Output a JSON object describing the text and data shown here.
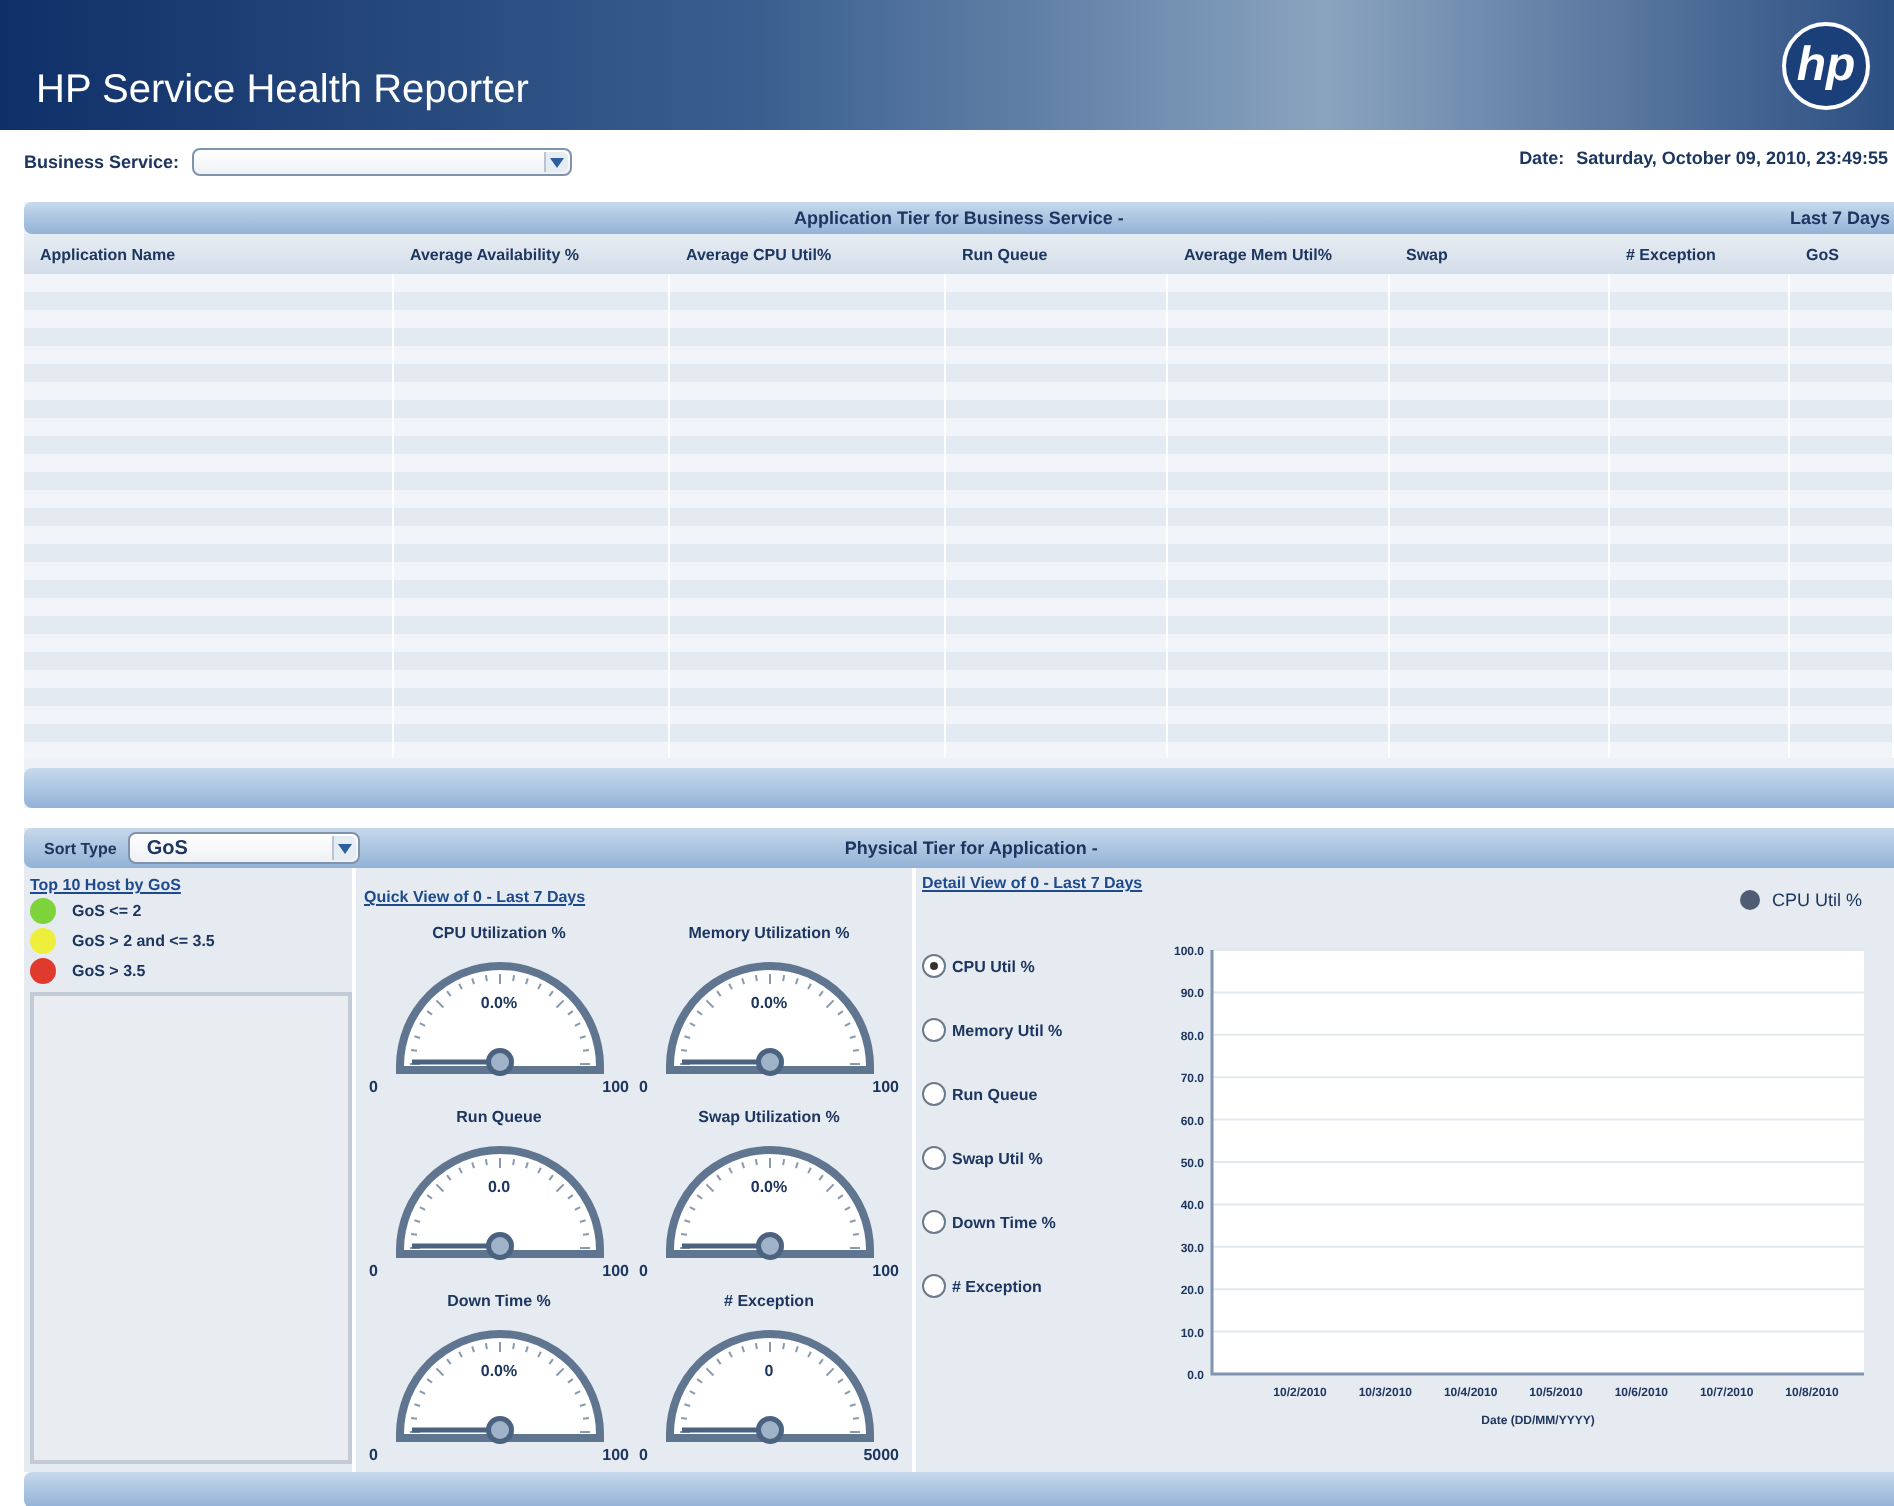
{
  "header": {
    "title": "HP Service Health Reporter",
    "logo": "hp"
  },
  "business_service": {
    "label": "Business Service:"
  },
  "date": {
    "label": "Date:",
    "value": "Saturday, October 09, 2010, 23:49:55"
  },
  "application_tier": {
    "title": "Application Tier for Business Service -",
    "range": "Last 7 Days",
    "columns": [
      "Application Name",
      "Average Availability %",
      "Average CPU Util%",
      "Run Queue",
      "Average Mem Util%",
      "Swap",
      "# Exception",
      "GoS"
    ]
  },
  "physical_tier": {
    "sort_label": "Sort Type",
    "sort_value": "GoS",
    "title": "Physical Tier for Application -",
    "hosts": {
      "title": "Top 10 Host by GoS",
      "legend": [
        {
          "label": "GoS <= 2",
          "color": "#7ed23a"
        },
        {
          "label": "GoS > 2 and <= 3.5",
          "color": "#eeee3c"
        },
        {
          "label": "GoS > 3.5",
          "color": "#e03a2e"
        }
      ]
    },
    "quick_view": {
      "title": "Quick View of 0 - Last 7 Days",
      "gauges": [
        {
          "title": "CPU Utilization %",
          "reading": "0.0%",
          "min": "0",
          "max": "100"
        },
        {
          "title": "Memory Utilization %",
          "reading": "0.0%",
          "min": "0",
          "max": "100"
        },
        {
          "title": "Run Queue",
          "reading": "0.0",
          "min": "0",
          "max": "100"
        },
        {
          "title": "Swap Utilization %",
          "reading": "0.0%",
          "min": "0",
          "max": "100"
        },
        {
          "title": "Down Time %",
          "reading": "0.0%",
          "min": "0",
          "max": "100"
        },
        {
          "title": "# Exception",
          "reading": "0",
          "min": "0",
          "max": "5000"
        }
      ]
    },
    "detail_view": {
      "title": "Detail View of 0  - Last 7 Days",
      "metrics": [
        {
          "label": "CPU Util %",
          "selected": true
        },
        {
          "label": "Memory  Util %",
          "selected": false
        },
        {
          "label": "Run Queue",
          "selected": false
        },
        {
          "label": "Swap Util %",
          "selected": false
        },
        {
          "label": "Down Time %",
          "selected": false
        },
        {
          "label": "# Exception",
          "selected": false
        }
      ],
      "chart_data": {
        "type": "line",
        "grid": true,
        "xlabel": "Date (DD/MM/YYYY)",
        "categories": [
          "10/2/2010",
          "10/3/2010",
          "10/4/2010",
          "10/5/2010",
          "10/6/2010",
          "10/7/2010",
          "10/8/2010"
        ],
        "series": [
          {
            "name": "CPU Util %",
            "color": "#4f5d73",
            "values": [
              null,
              null,
              null,
              null,
              null,
              null,
              null
            ]
          }
        ],
        "ylim": [
          0,
          100
        ],
        "yticks": [
          {
            "value": 0,
            "label": "0.0"
          },
          {
            "value": 10,
            "label": "10.0"
          },
          {
            "value": 20,
            "label": "20.0"
          },
          {
            "value": 30,
            "label": "30.0"
          },
          {
            "value": 40,
            "label": "40.0"
          },
          {
            "value": 50,
            "label": "50.0"
          },
          {
            "value": 60,
            "label": "60.0"
          },
          {
            "value": 70,
            "label": "70.0"
          },
          {
            "value": 80,
            "label": "80.0"
          },
          {
            "value": 90,
            "label": "90.0"
          },
          {
            "value": 100,
            "label": "100.0"
          }
        ]
      }
    }
  }
}
